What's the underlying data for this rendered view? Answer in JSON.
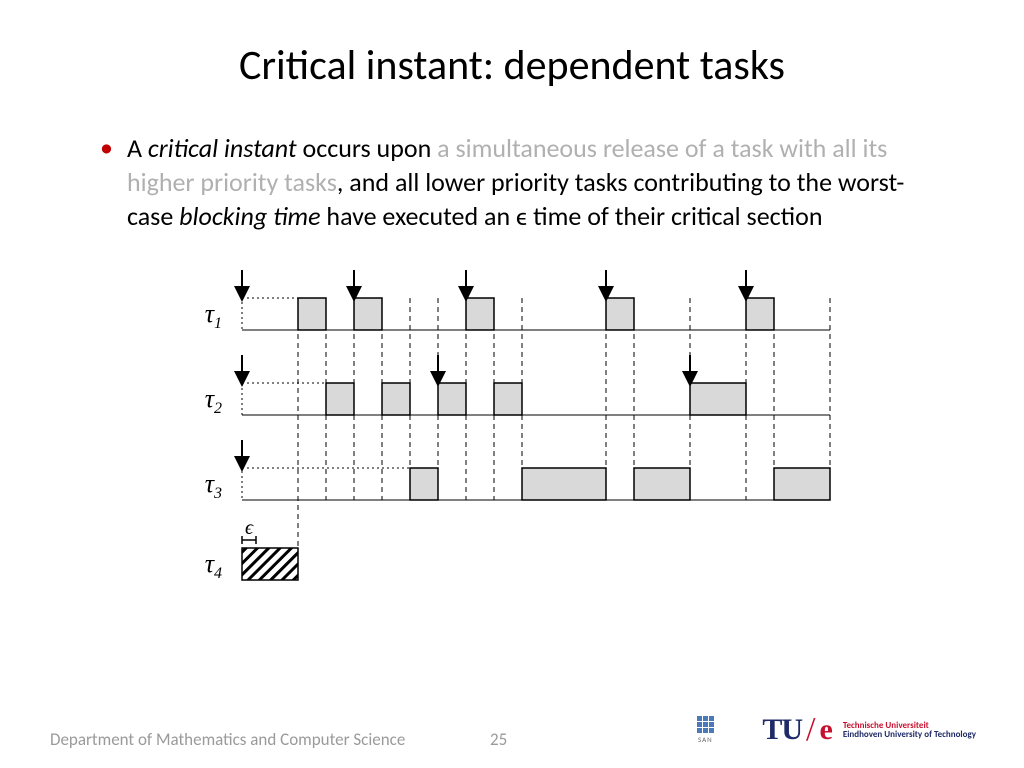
{
  "title": "Critical instant: dependent tasks",
  "bullet": {
    "t1": "A ",
    "t2": "critical instant",
    "t3": " occurs upon ",
    "t4": "a simultaneous release of a task with all its higher priority tasks",
    "t5": ", and all lower priority tasks contributing to the worst-case ",
    "t6": "blocking time",
    "t7": " have executed an ϵ time of their critical section"
  },
  "footer": {
    "dept": "Department of Mathematics and Computer Science",
    "page": "25",
    "san": "SAN",
    "uni1": "Technische Universiteit",
    "uni2a": "Eindhoven",
    "uni2b": "University of Technology"
  },
  "chart_data": {
    "type": "gantt",
    "description": "Task scheduling timeline showing critical instant for dependent tasks under fixed-priority scheduling. Time units are approximate, read from block widths.",
    "tasks": [
      {
        "name": "τ1",
        "priority": 1,
        "releases": [
          0,
          4,
          8,
          13,
          18
        ],
        "executions": [
          {
            "start": 2,
            "end": 3
          },
          {
            "start": 4,
            "end": 5
          },
          {
            "start": 8,
            "end": 9
          },
          {
            "start": 13,
            "end": 14
          },
          {
            "start": 18,
            "end": 19
          }
        ]
      },
      {
        "name": "τ2",
        "priority": 2,
        "releases": [
          0,
          7,
          16
        ],
        "executions": [
          {
            "start": 3,
            "end": 4
          },
          {
            "start": 5,
            "end": 6
          },
          {
            "start": 7,
            "end": 8
          },
          {
            "start": 9,
            "end": 10
          },
          {
            "start": 16,
            "end": 18
          }
        ]
      },
      {
        "name": "τ3",
        "priority": 3,
        "releases": [
          0
        ],
        "executions": [
          {
            "start": 6,
            "end": 7
          },
          {
            "start": 10,
            "end": 13
          },
          {
            "start": 14,
            "end": 16
          },
          {
            "start": 19,
            "end": 21
          }
        ]
      },
      {
        "name": "τ4",
        "priority": 4,
        "epsilon_label": "ϵ",
        "epsilon_range": [
          0,
          0.5
        ],
        "executions": [
          {
            "start": 0,
            "end": 2,
            "critical_section": true
          }
        ]
      }
    ]
  }
}
